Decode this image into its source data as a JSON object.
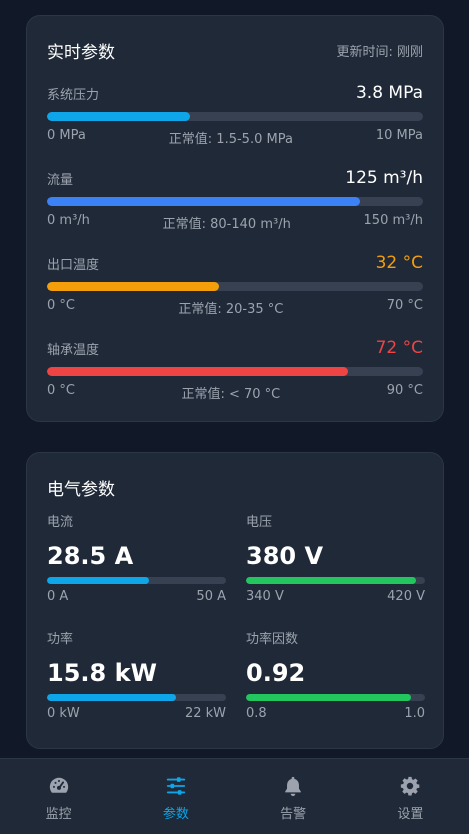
{
  "realtime": {
    "title": "实时参数",
    "update_time": "更新时间: 刚刚",
    "params": [
      {
        "label": "系统压力",
        "value": "3.8 MPa",
        "value_color": "#ffffff",
        "bar_color": "#0ea5e9",
        "level": 0.38,
        "min": "0 MPa",
        "normal": "正常值: 1.5-5.0 MPa",
        "max": "10 MPa"
      },
      {
        "label": "流量",
        "value": "125 m³/h",
        "value_color": "#ffffff",
        "bar_color": "#3b82f6",
        "level": 0.833,
        "min": "0 m³/h",
        "normal": "正常值: 80-140 m³/h",
        "max": "150 m³/h"
      },
      {
        "label": "出口温度",
        "value": "32 °C",
        "value_color": "#f59e0b",
        "bar_color": "#f59e0b",
        "level": 0.457,
        "min": "0 °C",
        "normal": "正常值: 20-35 °C",
        "max": "70 °C"
      },
      {
        "label": "轴承温度",
        "value": "72 °C",
        "value_color": "#ef4444",
        "bar_color": "#ef4444",
        "level": 0.8,
        "min": "0 °C",
        "normal": "正常值: < 70 °C",
        "max": "90 °C"
      }
    ]
  },
  "electrical": {
    "title": "电气参数",
    "cells": [
      {
        "label": "电流",
        "value": "28.5 A",
        "bar_color": "#0ea5e9",
        "level": 0.57,
        "min": "0 A",
        "max": "50 A"
      },
      {
        "label": "电压",
        "value": "380 V",
        "bar_color": "#22c55e",
        "level": 0.95,
        "min": "340 V",
        "max": "420 V"
      },
      {
        "label": "功率",
        "value": "15.8 kW",
        "bar_color": "#0ea5e9",
        "level": 0.72,
        "min": "0 kW",
        "max": "22 kW"
      },
      {
        "label": "功率因数",
        "value": "0.92",
        "bar_color": "#22c55e",
        "level": 0.92,
        "min": "0.8",
        "max": "1.0"
      }
    ]
  },
  "nav": {
    "active_color": "#0ea5e9",
    "items": [
      {
        "label": "监控",
        "icon": "gauge-icon",
        "active": false
      },
      {
        "label": "参数",
        "icon": "sliders-icon",
        "active": true
      },
      {
        "label": "告警",
        "icon": "bell-icon",
        "active": false
      },
      {
        "label": "设置",
        "icon": "gear-icon",
        "active": false
      }
    ]
  }
}
